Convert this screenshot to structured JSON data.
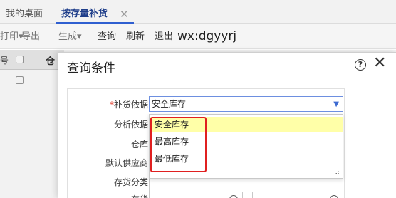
{
  "tabs": {
    "home": "我的桌面",
    "active": "按存量补货",
    "close_glyph": "✕"
  },
  "toolbar": {
    "print": "打印▾",
    "export": "导出",
    "generate": "生成▾",
    "query": "查询",
    "refresh": "刷新",
    "exit": "退出",
    "user": "wx:dgyyrj"
  },
  "grid": {
    "num_header": "号",
    "col_header": "仓"
  },
  "dialog": {
    "title": "查询条件",
    "help_glyph": "?",
    "close_glyph": "✕"
  },
  "form": {
    "basis": {
      "required_mark": "*",
      "label": "补货依据",
      "value": "安全库存"
    },
    "analysis": {
      "label": "分析依据"
    },
    "warehouse": {
      "label": "仓库"
    },
    "supplier": {
      "label": "默认供应商"
    },
    "category": {
      "label": "存货分类"
    },
    "inventory": {
      "label": "存货"
    }
  },
  "dropdown": {
    "options": [
      "安全库存",
      "最高库存",
      "最低库存"
    ],
    "selected_index": 0
  },
  "icons": {
    "dropdown_chevron": "chevron-down-icon",
    "resize": "resize-grip-icon",
    "search": "search-icon"
  },
  "colors": {
    "selected_option": "#ffffa8",
    "highlight": "#e02020",
    "active_tab_underline": "#2f5fd0"
  }
}
